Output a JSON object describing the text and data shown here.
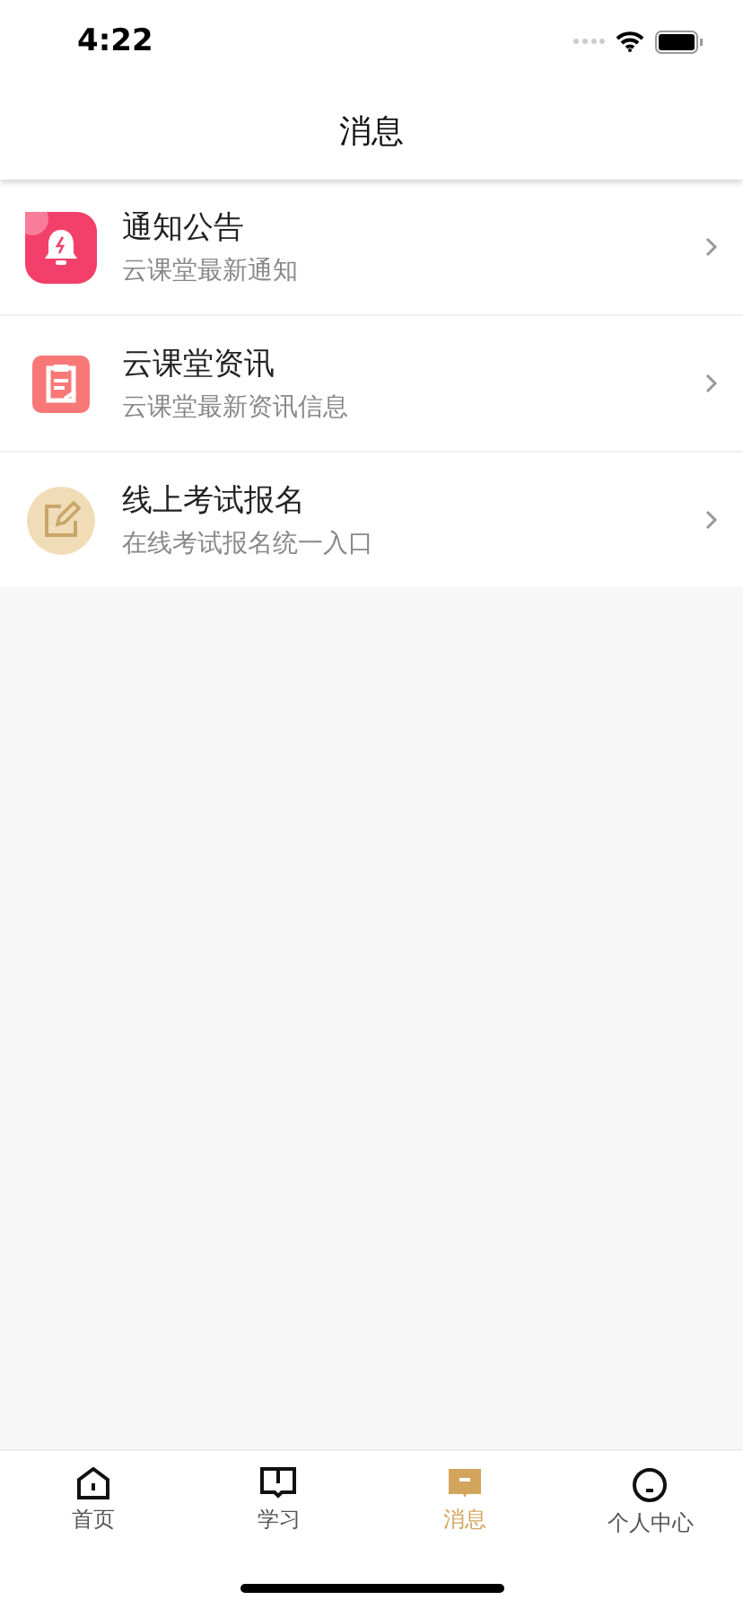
{
  "status_bar": {
    "time": "4:22"
  },
  "nav": {
    "title": "消息"
  },
  "messages": [
    {
      "kind": "bell",
      "title": "通知公告",
      "subtitle": "云课堂最新通知"
    },
    {
      "kind": "clipboard",
      "title": "云课堂资讯",
      "subtitle": "云课堂最新资讯信息"
    },
    {
      "kind": "edit",
      "title": "线上考试报名",
      "subtitle": "在线考试报名统一入口"
    }
  ],
  "tab_bar": [
    {
      "kind": "home",
      "label": "首页",
      "selected": false
    },
    {
      "kind": "book",
      "label": "学习",
      "selected": false
    },
    {
      "kind": "message",
      "label": "消息",
      "selected": true
    },
    {
      "kind": "person",
      "label": "个人中心",
      "selected": false
    }
  ]
}
